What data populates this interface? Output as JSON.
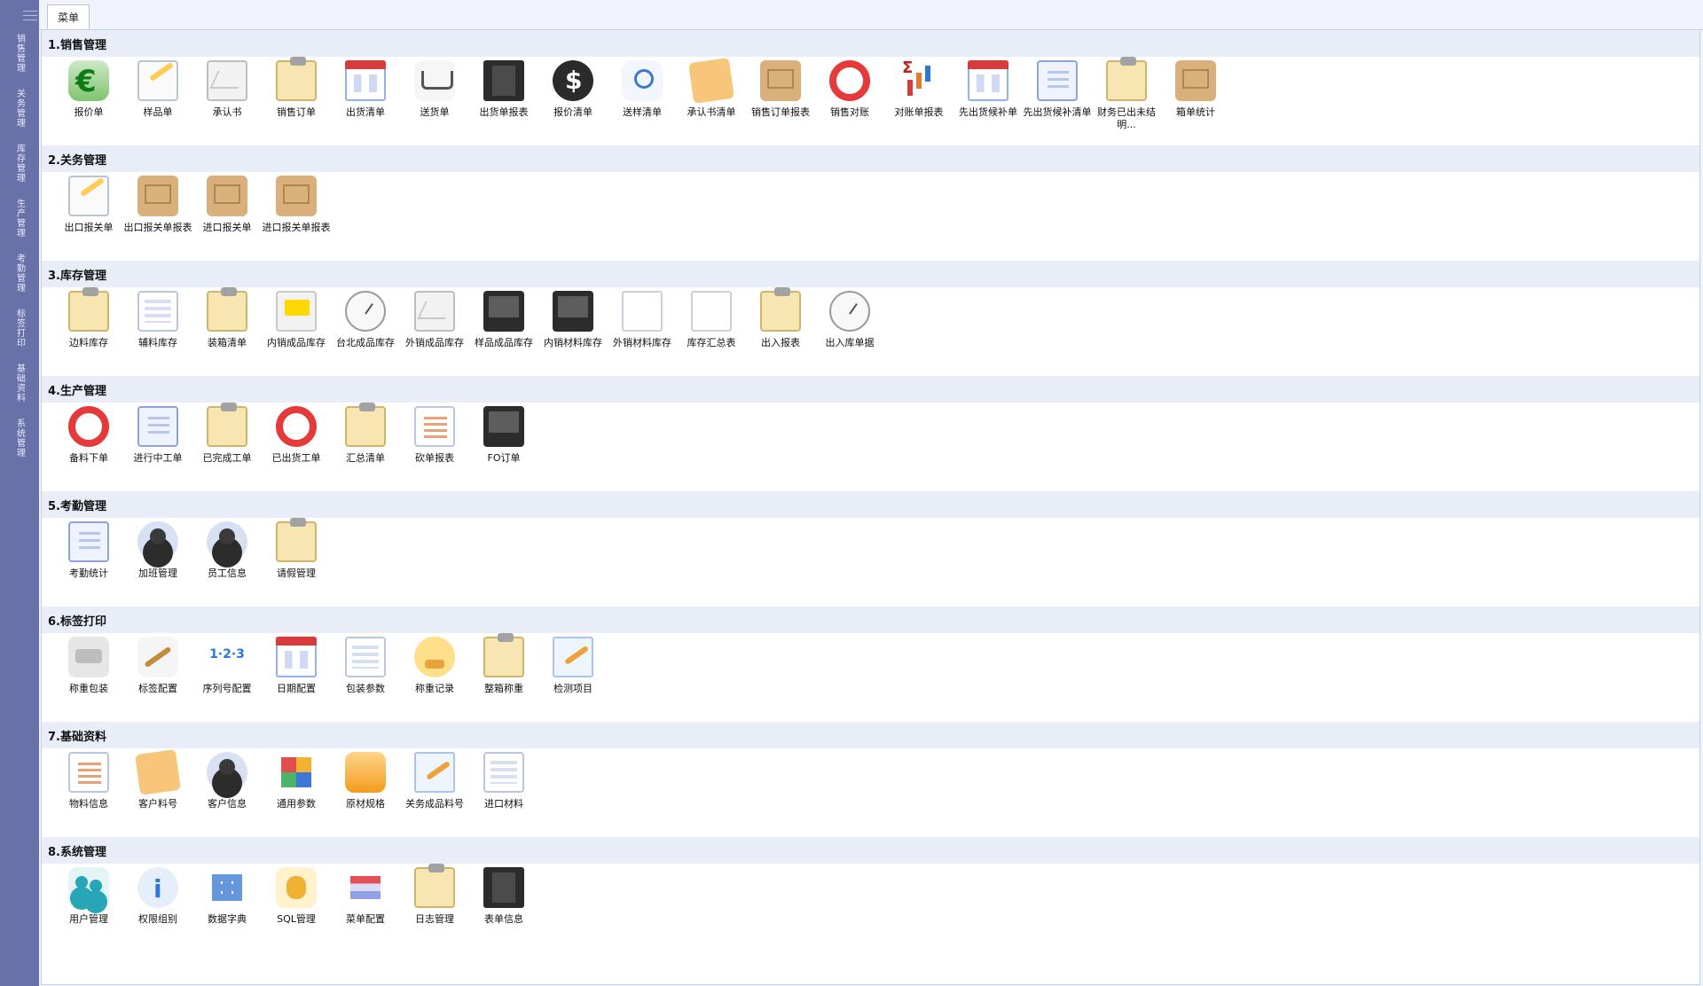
{
  "sidebar": {
    "items": [
      {
        "label": "销售管理"
      },
      {
        "label": "关务管理"
      },
      {
        "label": "库存管理"
      },
      {
        "label": "生产管理"
      },
      {
        "label": "考勤管理"
      },
      {
        "label": "标签打印"
      },
      {
        "label": "基础资料"
      },
      {
        "label": "系统管理"
      }
    ]
  },
  "tabs": {
    "active_label": "菜单"
  },
  "groups": [
    {
      "title": "1.销售管理",
      "items": [
        {
          "label": "报价单",
          "icon": "euro"
        },
        {
          "label": "样品单",
          "icon": "notebook"
        },
        {
          "label": "承认书",
          "icon": "envelope"
        },
        {
          "label": "销售订单",
          "icon": "clipboard"
        },
        {
          "label": "出货清单",
          "icon": "calendar"
        },
        {
          "label": "送货单",
          "icon": "cart"
        },
        {
          "label": "出货单报表",
          "icon": "book"
        },
        {
          "label": "报价清单",
          "icon": "coins"
        },
        {
          "label": "送样清单",
          "icon": "search"
        },
        {
          "label": "承认书清单",
          "icon": "note"
        },
        {
          "label": "销售订单报表",
          "icon": "box"
        },
        {
          "label": "销售对账",
          "icon": "lifebuoy"
        },
        {
          "label": "对账单报表",
          "icon": "bars"
        },
        {
          "label": "先出货候补单",
          "icon": "calendar"
        },
        {
          "label": "先出货候补清单",
          "icon": "checklist"
        },
        {
          "label": "财务已出未结明...",
          "icon": "clipboard"
        },
        {
          "label": "箱单统计",
          "icon": "box"
        }
      ]
    },
    {
      "title": "2.关务管理",
      "items": [
        {
          "label": "出口报关单",
          "icon": "notebook"
        },
        {
          "label": "出口报关单报表",
          "icon": "box"
        },
        {
          "label": "进口报关单",
          "icon": "box"
        },
        {
          "label": "进口报关单报表",
          "icon": "box"
        }
      ]
    },
    {
      "title": "3.库存管理",
      "items": [
        {
          "label": "边料库存",
          "icon": "clipboard"
        },
        {
          "label": "辅料库存",
          "icon": "table"
        },
        {
          "label": "装箱清单",
          "icon": "clipboard"
        },
        {
          "label": "内销成品库存",
          "icon": "yellowscreen"
        },
        {
          "label": "台北成品库存",
          "icon": "clock"
        },
        {
          "label": "外销成品库存",
          "icon": "envelope"
        },
        {
          "label": "样品成品库存",
          "icon": "monitor"
        },
        {
          "label": "内销材料库存",
          "icon": "monitor"
        },
        {
          "label": "外销材料库存",
          "icon": "page"
        },
        {
          "label": "库存汇总表",
          "icon": "page"
        },
        {
          "label": "出入报表",
          "icon": "clipboard"
        },
        {
          "label": "出入库单据",
          "icon": "clock"
        }
      ]
    },
    {
      "title": "4.生产管理",
      "items": [
        {
          "label": "备料下单",
          "icon": "lifebuoy"
        },
        {
          "label": "进行中工单",
          "icon": "checklist"
        },
        {
          "label": "已完成工单",
          "icon": "clipboard"
        },
        {
          "label": "已出货工单",
          "icon": "lifebuoy"
        },
        {
          "label": "汇总清单",
          "icon": "clipboard"
        },
        {
          "label": "砍单报表",
          "icon": "doclist"
        },
        {
          "label": "FO订单",
          "icon": "monitor"
        }
      ]
    },
    {
      "title": "5.考勤管理",
      "items": [
        {
          "label": "考勤统计",
          "icon": "checklist"
        },
        {
          "label": "加班管理",
          "icon": "person"
        },
        {
          "label": "员工信息",
          "icon": "person"
        },
        {
          "label": "请假管理",
          "icon": "clipboard"
        }
      ]
    },
    {
      "title": "6.标签打印",
      "items": [
        {
          "label": "称重包装",
          "icon": "printer"
        },
        {
          "label": "标签配置",
          "icon": "tools"
        },
        {
          "label": "序列号配置",
          "icon": "seq"
        },
        {
          "label": "日期配置",
          "icon": "calendar"
        },
        {
          "label": "包装参数",
          "icon": "table"
        },
        {
          "label": "称重记录",
          "icon": "stamp"
        },
        {
          "label": "整箱称重",
          "icon": "clipboard"
        },
        {
          "label": "检测项目",
          "icon": "pencilpage"
        }
      ]
    },
    {
      "title": "7.基础资料",
      "items": [
        {
          "label": "物料信息",
          "icon": "doclist"
        },
        {
          "label": "客户料号",
          "icon": "note"
        },
        {
          "label": "客户信息",
          "icon": "person"
        },
        {
          "label": "通用参数",
          "icon": "grid4"
        },
        {
          "label": "原材规格",
          "icon": "orange"
        },
        {
          "label": "关务成品料号",
          "icon": "pencilpage"
        },
        {
          "label": "进口材料",
          "icon": "table"
        }
      ]
    },
    {
      "title": "8.系统管理",
      "items": [
        {
          "label": "用户管理",
          "icon": "usergroup"
        },
        {
          "label": "权限组别",
          "icon": "info"
        },
        {
          "label": "数据字典",
          "icon": "blocks"
        },
        {
          "label": "SQL管理",
          "icon": "db"
        },
        {
          "label": "菜单配置",
          "icon": "striped"
        },
        {
          "label": "日志管理",
          "icon": "clipboard"
        },
        {
          "label": "表单信息",
          "icon": "book"
        }
      ]
    }
  ]
}
